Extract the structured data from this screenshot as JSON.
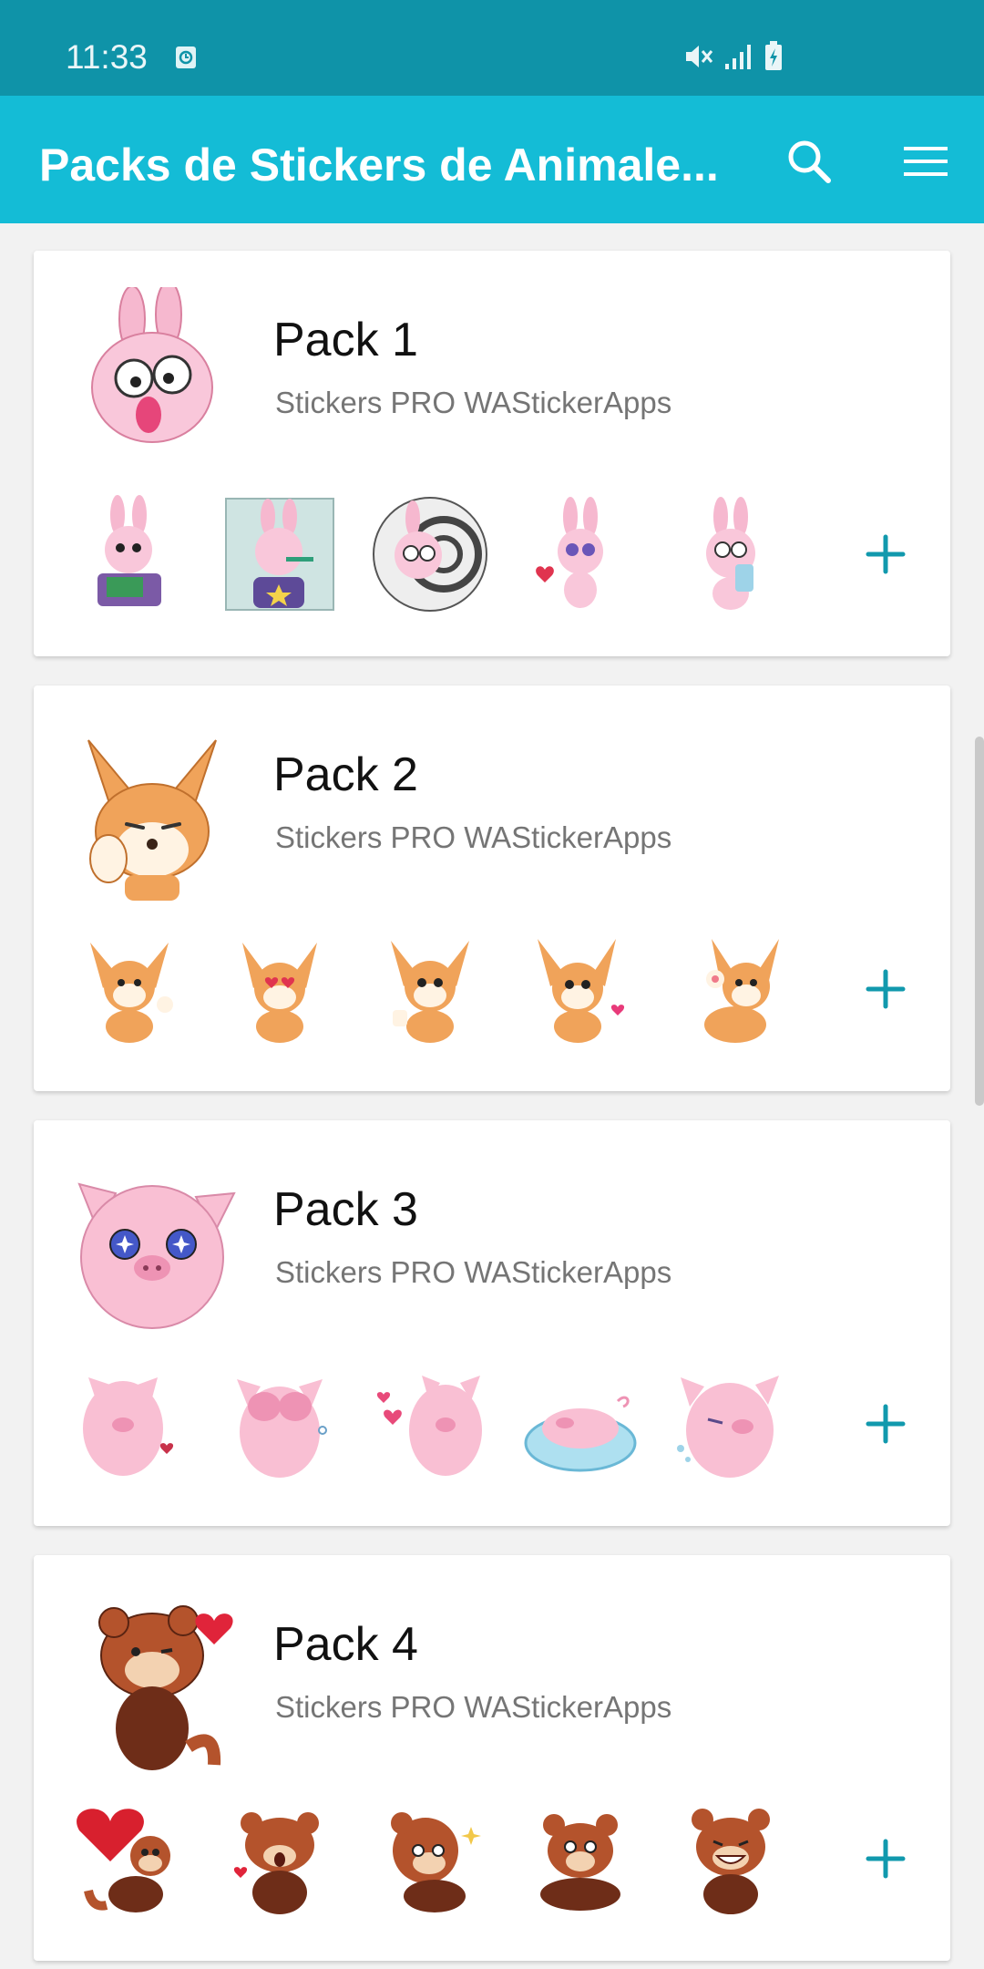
{
  "status_bar": {
    "time": "11:33",
    "icons": [
      "alarm-icon",
      "mute-icon",
      "signal-icon",
      "battery-charging-icon"
    ]
  },
  "app_bar": {
    "title": "Packs de Stickers de Animale...",
    "icons": [
      "search-icon",
      "menu-icon"
    ],
    "color": "#14bcd6"
  },
  "packs": [
    {
      "name": "Pack 1",
      "publisher": "Stickers PRO WAStickerApps",
      "theme": "pink-bunny",
      "palette": [
        "#f6b8cf",
        "#e88fb2",
        "#ffffff"
      ],
      "stickers": [
        "bunny-reading",
        "bunny-brushing-teeth",
        "bunny-hypnotized",
        "bunny-in-love",
        "bunny-crying"
      ]
    },
    {
      "name": "Pack 2",
      "publisher": "Stickers PRO WAStickerApps",
      "theme": "fennec-fox",
      "palette": [
        "#f0a35a",
        "#d97b32",
        "#fff3e3"
      ],
      "stickers": [
        "fox-waving",
        "fox-heart-eyes",
        "fox-thumbs-up",
        "fox-heart",
        "fox-wave-paw"
      ]
    },
    {
      "name": "Pack 3",
      "publisher": "Stickers PRO WAStickerApps",
      "theme": "pink-pig",
      "palette": [
        "#f9bfd3",
        "#ee93b4",
        "#ffe3ec"
      ],
      "stickers": [
        "pig-broken-heart",
        "pig-hiding",
        "pig-hearts",
        "pig-pool",
        "pig-crying"
      ]
    },
    {
      "name": "Pack 4",
      "publisher": "Stickers PRO WAStickerApps",
      "theme": "red-panda",
      "palette": [
        "#b4532c",
        "#6e2d18",
        "#f3d2b1"
      ],
      "stickers": [
        "panda-heart-balloon",
        "panda-shocked",
        "panda-playful",
        "panda-scared",
        "panda-laughing"
      ]
    }
  ],
  "add_label": "+",
  "accent_color": "#1199ad"
}
